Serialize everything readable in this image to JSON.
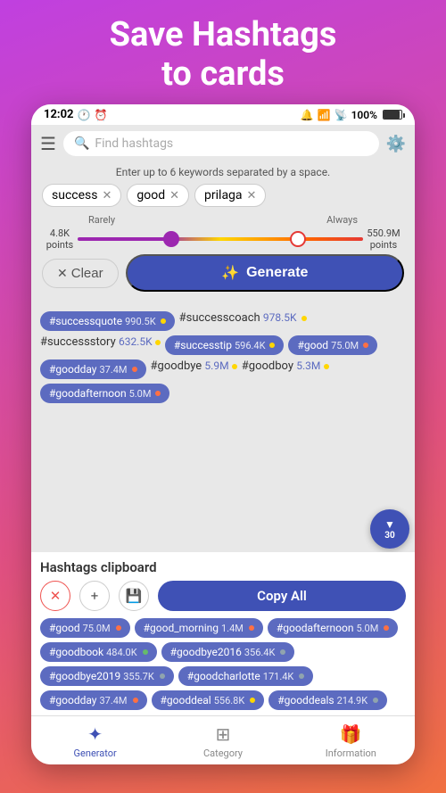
{
  "title": "Save Hashtags\nto cards",
  "status": {
    "time": "12:02",
    "battery": "100%"
  },
  "search": {
    "placeholder": "Find hashtags"
  },
  "hint": "Enter up to 6 keywords separated by a space.",
  "tags": [
    {
      "label": "success"
    },
    {
      "label": "good"
    },
    {
      "label": "prilaga"
    }
  ],
  "slider": {
    "left_label": "Rarely",
    "right_label": "Always",
    "left_points": "4.8K\npoints",
    "right_points": "550.9M\npoints"
  },
  "buttons": {
    "clear": "Clear",
    "generate": "Generate"
  },
  "results": [
    {
      "tag": "#successquote",
      "count": "990.5K",
      "dot": "yellow"
    },
    {
      "tag": "#successcoach",
      "count": "978.5K",
      "dot": "yellow"
    },
    {
      "tag": "#successstory",
      "count": "632.5K",
      "dot": "yellow",
      "plain": true
    },
    {
      "tag": "#successtip",
      "count": "596.4K",
      "dot": "yellow"
    },
    {
      "tag": "#good",
      "count": "75.0M",
      "dot": "red"
    },
    {
      "tag": "#goodday",
      "count": "37.4M",
      "dot": "red"
    },
    {
      "tag": "#goodbye",
      "count": "5.9M",
      "dot": "yellow",
      "plain": true
    },
    {
      "tag": "#goodboy",
      "count": "5.3M",
      "dot": "yellow",
      "plain": true
    },
    {
      "tag": "#goodafternoon",
      "count": "5.0M",
      "dot": "red"
    }
  ],
  "float_btn": {
    "icon": "▼",
    "count": "30"
  },
  "clipboard": {
    "title": "Hashtags clipboard",
    "copy_all": "Copy All",
    "chips": [
      {
        "tag": "#good",
        "count": "75.0M",
        "dot": "red"
      },
      {
        "tag": "#good_morning",
        "count": "1.4M",
        "dot": "red"
      },
      {
        "tag": "#goodafternoon",
        "count": "5.0M",
        "dot": "red"
      },
      {
        "tag": "#goodbook",
        "count": "484.0K",
        "dot": "green"
      },
      {
        "tag": "#goodbye2016",
        "count": "356.4K",
        "dot": "grey"
      },
      {
        "tag": "#goodbye2019",
        "count": "355.7K",
        "dot": "grey"
      },
      {
        "tag": "#goodcharlotte",
        "count": "171.4K",
        "dot": "grey"
      },
      {
        "tag": "#goodday",
        "count": "37.4M",
        "dot": "red"
      },
      {
        "tag": "#gooddeal",
        "count": "556.8K",
        "dot": "yellow"
      },
      {
        "tag": "#gooddeals",
        "count": "214.9K",
        "dot": "grey"
      }
    ]
  },
  "nav": {
    "items": [
      {
        "label": "Generator",
        "icon": "✦",
        "active": true
      },
      {
        "label": "Category",
        "icon": "⊞",
        "active": false
      },
      {
        "label": "Information",
        "icon": "🎁",
        "active": false
      }
    ]
  }
}
